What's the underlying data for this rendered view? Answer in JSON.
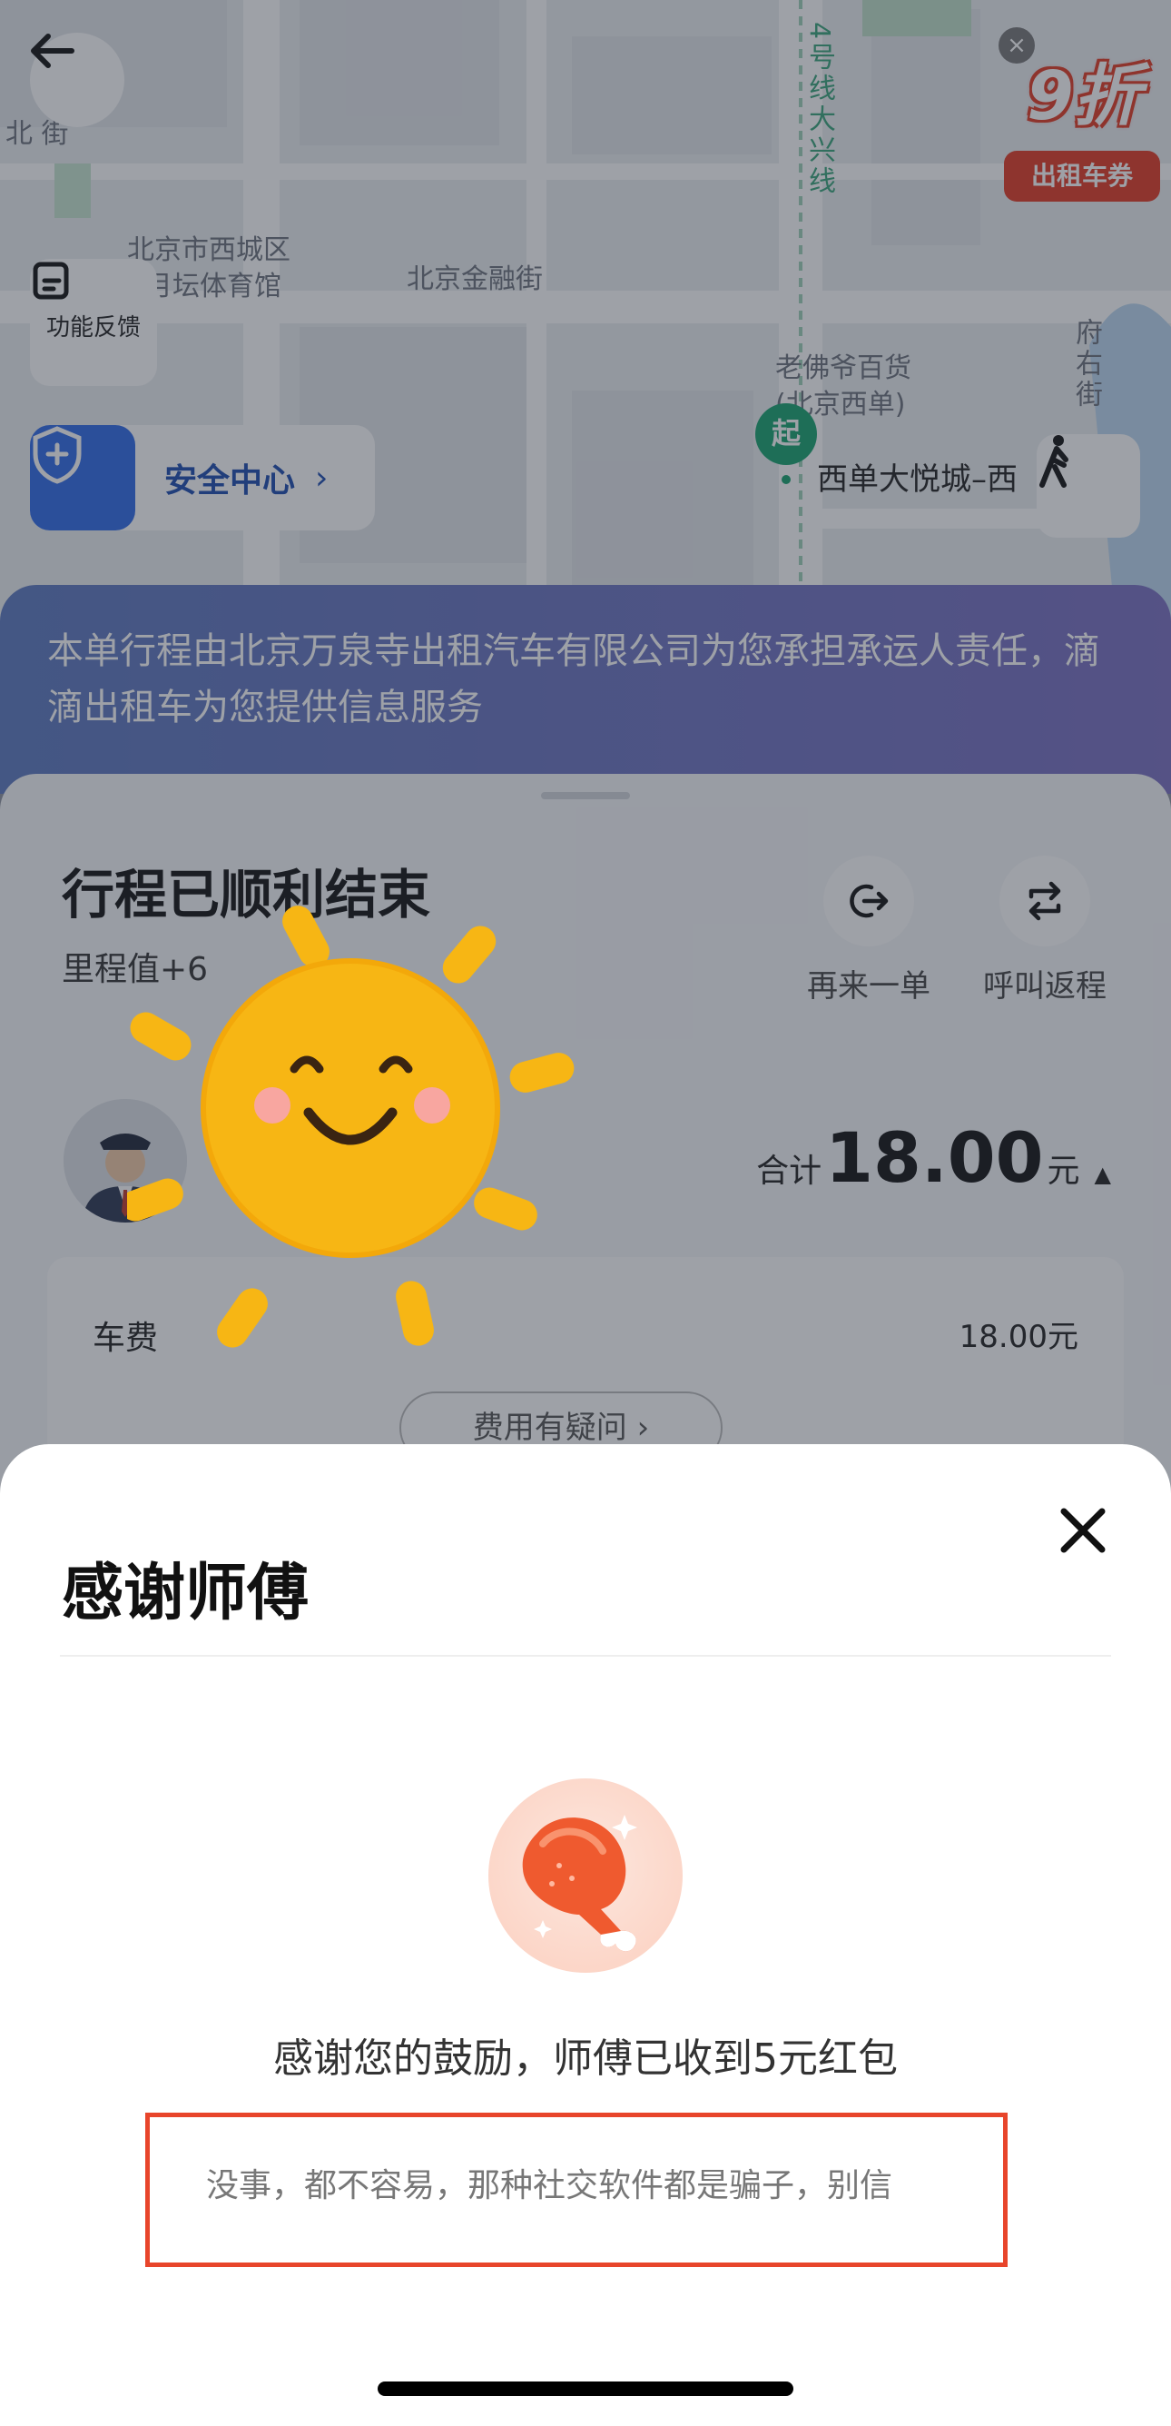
{
  "map": {
    "labels": {
      "bei_jie": "北 街",
      "xicheng": "北京市西城区",
      "xicheng2": "月坛体育馆",
      "finance_st": "北京金融街",
      "line4": "4号线大兴线",
      "laofoye": "老佛爷百货",
      "laofoye2": "(北京西单)",
      "fuyou": "府右街",
      "destination": "西单大悦城–西"
    },
    "start_marker": "起"
  },
  "buttons": {
    "feedback_label": "功能反馈",
    "safety_label": "安全中心",
    "safety_chevron": "›"
  },
  "coupon": {
    "close": "×",
    "discount": "9折",
    "tag": "出租车券"
  },
  "notice": {
    "text": "本单行程由北京万泉寺出租汽车有限公司为您承担承运人责任，滴滴出租车为您提供信息服务"
  },
  "trip": {
    "title": "行程已顺利结束",
    "mileage": "里程值+6",
    "actions": [
      {
        "label": "再来一单"
      },
      {
        "label": "呼叫返程"
      }
    ],
    "total_prefix": "合计",
    "total_amount": "18.00",
    "total_unit": "元",
    "total_caret": "▲",
    "fee_name": "车费",
    "fee_value": "18.00元",
    "fee_question": "费用有疑问 ›"
  },
  "sheet": {
    "title": "感谢师傅",
    "thank_text": "感谢您的鼓励，师傅已收到5元红包",
    "message": "没事，都不容易，那种社交软件都是骗子，别信"
  },
  "colors": {
    "safety_blue": "#2f6ae8",
    "start_green": "#17a36d",
    "highlight_red": "#e8452b",
    "sun_yellow": "#f7b614"
  }
}
